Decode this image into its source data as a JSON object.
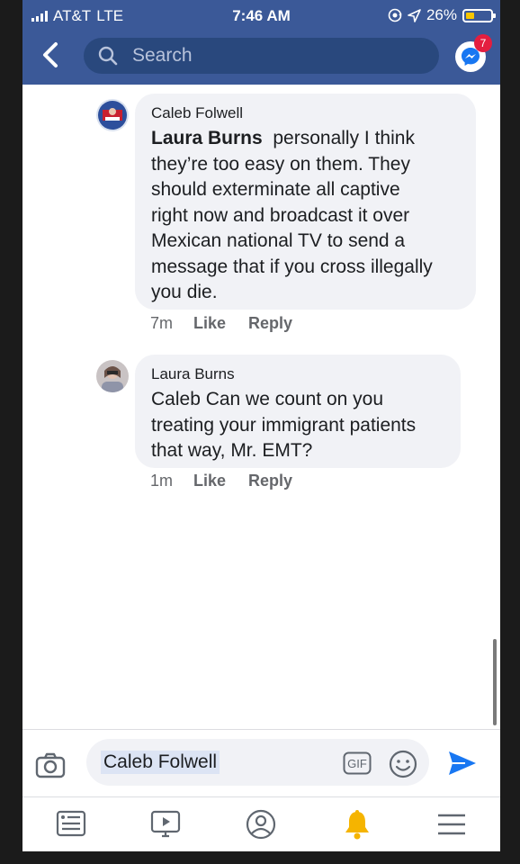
{
  "status_bar": {
    "carrier": "AT&T",
    "network": "LTE",
    "time": "7:46 AM",
    "battery_percent": "26%",
    "icons": [
      "signal-bars-icon",
      "screen-lock-icon",
      "location-arrow-icon",
      "battery-icon"
    ]
  },
  "header": {
    "search_placeholder": "Search",
    "messenger_badge": "7",
    "colors": {
      "bar": "#3b5998",
      "search_field": "#29487d",
      "badge": "#e41e3f"
    }
  },
  "comments": [
    {
      "author": "Caleb Folwell",
      "mention": "Laura Burns",
      "lines": [
        "personally I think",
        "they’re too easy on them. They",
        "should exterminate all captive",
        "right now and broadcast it over",
        "Mexican national TV to send a",
        "message that if you cross illegally",
        "you die."
      ],
      "time": "7m",
      "like": "Like",
      "reply": "Reply"
    },
    {
      "author": "Laura Burns",
      "lines": [
        "Caleb Can we count on you",
        "treating your immigrant patients",
        "that way, Mr. EMT?"
      ],
      "time": "1m",
      "like": "Like",
      "reply": "Reply"
    }
  ],
  "composer": {
    "value": "Caleb Folwell",
    "gif_label": "GIF",
    "icons": [
      "camera-icon",
      "gif-icon",
      "emoji-icon",
      "send-icon"
    ],
    "colors": {
      "send": "#1877f2"
    }
  },
  "tab_bar": {
    "icons": [
      "news-feed-icon",
      "watch-icon",
      "profile-icon",
      "notifications-bell-icon",
      "menu-icon"
    ],
    "colors": {
      "bell": "#f5b400",
      "inactive": "#606770"
    }
  }
}
